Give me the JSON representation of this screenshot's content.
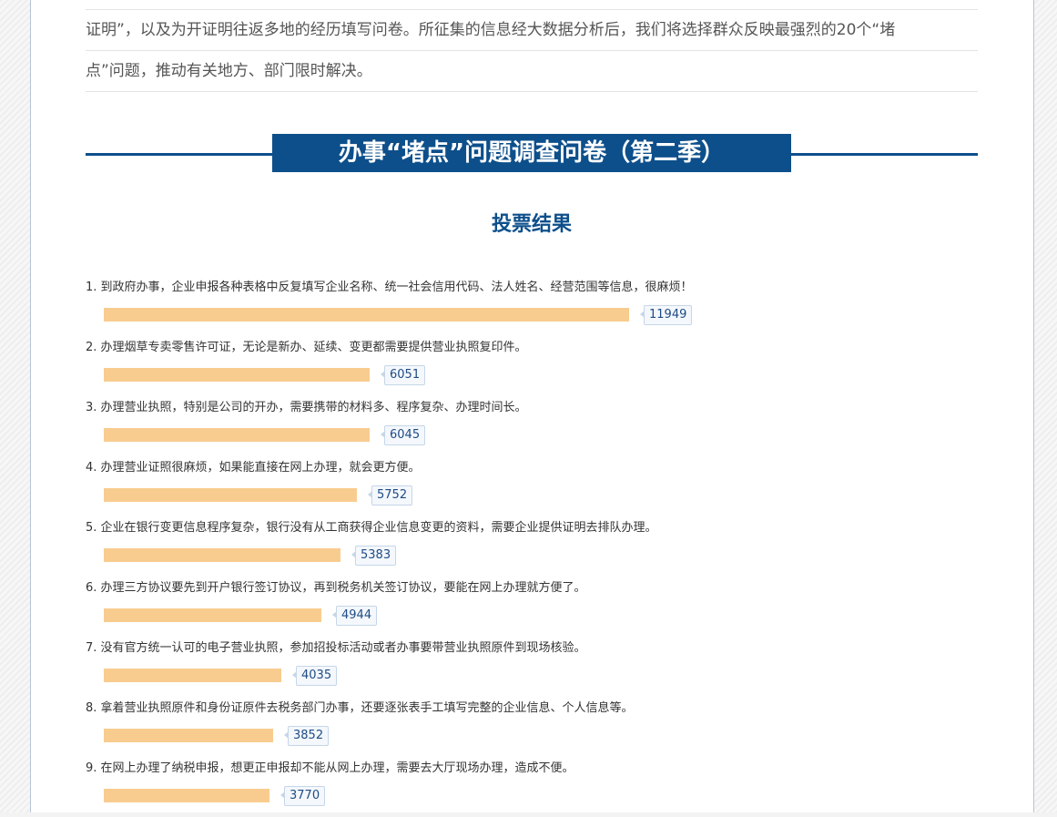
{
  "intro": {
    "lines": [
      "证明”，以及为开证明往返多地的经历填写问卷。所征集的信息经大数据分析后，我们将选择群众反映最强烈的20个“堵",
      "点”问题，推动有关地方、部门限时解决。"
    ]
  },
  "survey": {
    "title": "办事“堵点”问题调查问卷（第二季）",
    "results_heading": "投票结果"
  },
  "results": [
    {
      "text": "1. 到政府办事，企业申报各种表格中反复填写企业名称、统一社会信用代码、法人姓名、经营范围等信息，很麻烦！",
      "votes": 11949,
      "votes_label": "11949"
    },
    {
      "text": "2. 办理烟草专卖零售许可证，无论是新办、延续、变更都需要提供营业执照复印件。",
      "votes": 6051,
      "votes_label": "6051"
    },
    {
      "text": "3. 办理营业执照，特别是公司的开办，需要携带的材料多、程序复杂、办理时间长。",
      "votes": 6045,
      "votes_label": "6045"
    },
    {
      "text": "4. 办理营业证照很麻烦，如果能直接在网上办理，就会更方便。",
      "votes": 5752,
      "votes_label": "5752"
    },
    {
      "text": "5. 企业在银行变更信息程序复杂，银行没有从工商获得企业信息变更的资料，需要企业提供证明去排队办理。",
      "votes": 5383,
      "votes_label": "5383"
    },
    {
      "text": "6. 办理三方协议要先到开户银行签订协议，再到税务机关签订协议，要能在网上办理就方便了。",
      "votes": 4944,
      "votes_label": "4944"
    },
    {
      "text": "7. 没有官方统一认可的电子营业执照，参加招投标活动或者办事要带营业执照原件到现场核验。",
      "votes": 4035,
      "votes_label": "4035"
    },
    {
      "text": "8. 拿着营业执照原件和身份证原件去税务部门办事，还要逐张表手工填写完整的企业信息、个人信息等。",
      "votes": 3852,
      "votes_label": "3852"
    },
    {
      "text": "9. 在网上办理了纳税申报，想更正申报却不能从网上办理，需要去大厅现场办理，造成不便。",
      "votes": 3770,
      "votes_label": "3770"
    }
  ],
  "colors": {
    "accent": "#0d4f8b",
    "bar": "#f8cc8f",
    "count_text": "#1e4b86"
  }
}
